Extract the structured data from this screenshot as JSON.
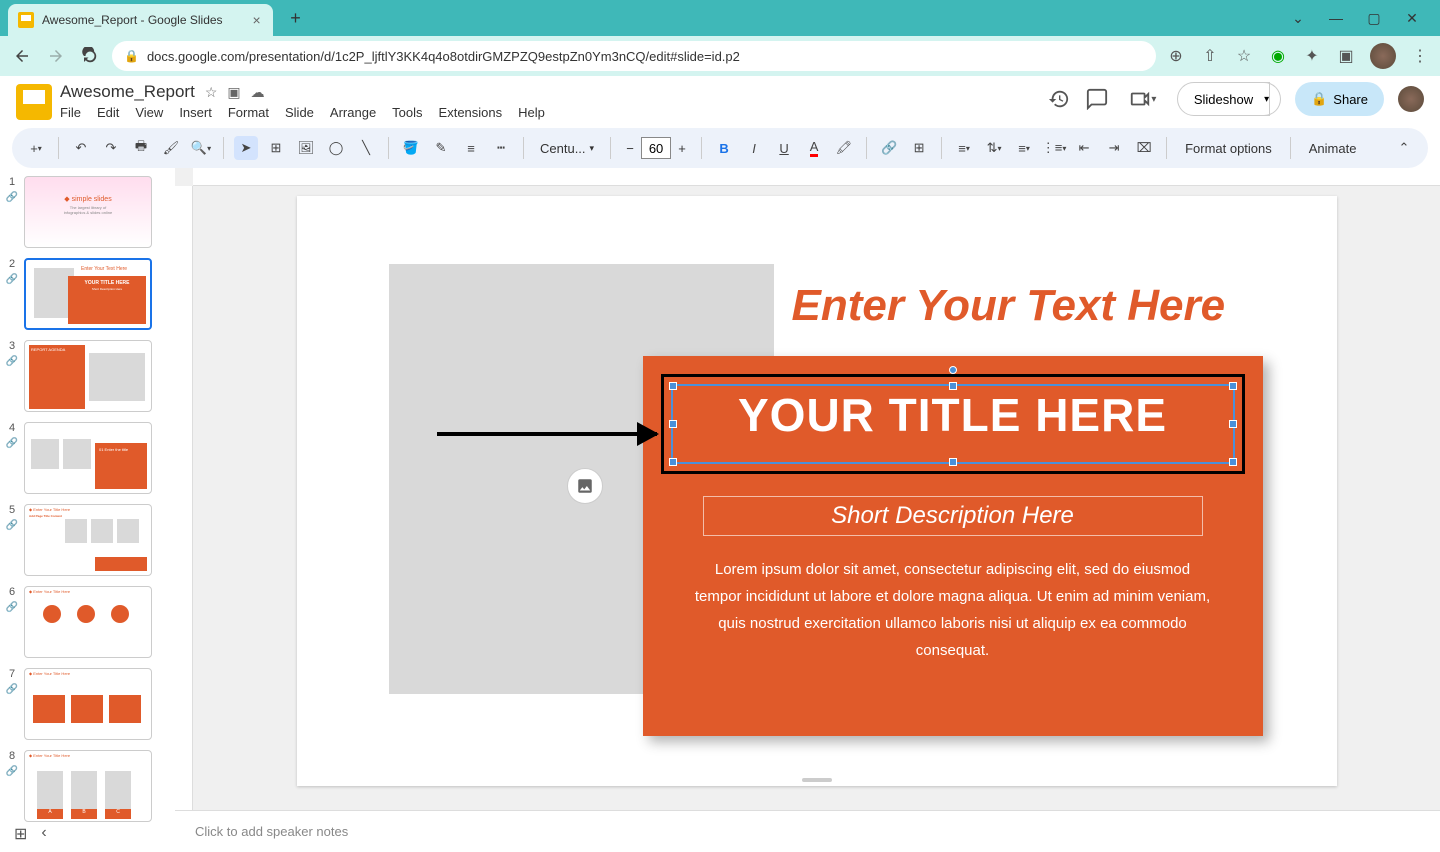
{
  "browser": {
    "tab_title": "Awesome_Report - Google Slides",
    "url": "docs.google.com/presentation/d/1c2P_ljftlY3KK4q4o8otdirGMZPZQ9estpZn0Ym3nCQ/edit#slide=id.p2"
  },
  "app": {
    "title": "Awesome_Report",
    "menus": [
      "File",
      "Edit",
      "View",
      "Insert",
      "Format",
      "Slide",
      "Arrange",
      "Tools",
      "Extensions",
      "Help"
    ],
    "slideshow_label": "Slideshow",
    "share_label": "Share"
  },
  "toolbar": {
    "font_name": "Centu...",
    "font_size": "60",
    "format_options": "Format options",
    "animate": "Animate"
  },
  "thumbs": [
    {
      "num": "1"
    },
    {
      "num": "2"
    },
    {
      "num": "3"
    },
    {
      "num": "4"
    },
    {
      "num": "5"
    },
    {
      "num": "6"
    },
    {
      "num": "7"
    },
    {
      "num": "8"
    }
  ],
  "slide": {
    "top_heading": "Enter Your Text Here",
    "card_title": "YOUR TITLE HERE",
    "card_subtitle": "Short Description Here",
    "card_body": "Lorem ipsum dolor sit amet, consectetur adipiscing elit, sed do eiusmod tempor incididunt ut labore et dolore magna aliqua. Ut enim ad minim veniam, quis nostrud exercitation ullamco laboris nisi ut aliquip ex ea commodo consequat."
  },
  "notes": {
    "placeholder": "Click to add speaker notes"
  }
}
